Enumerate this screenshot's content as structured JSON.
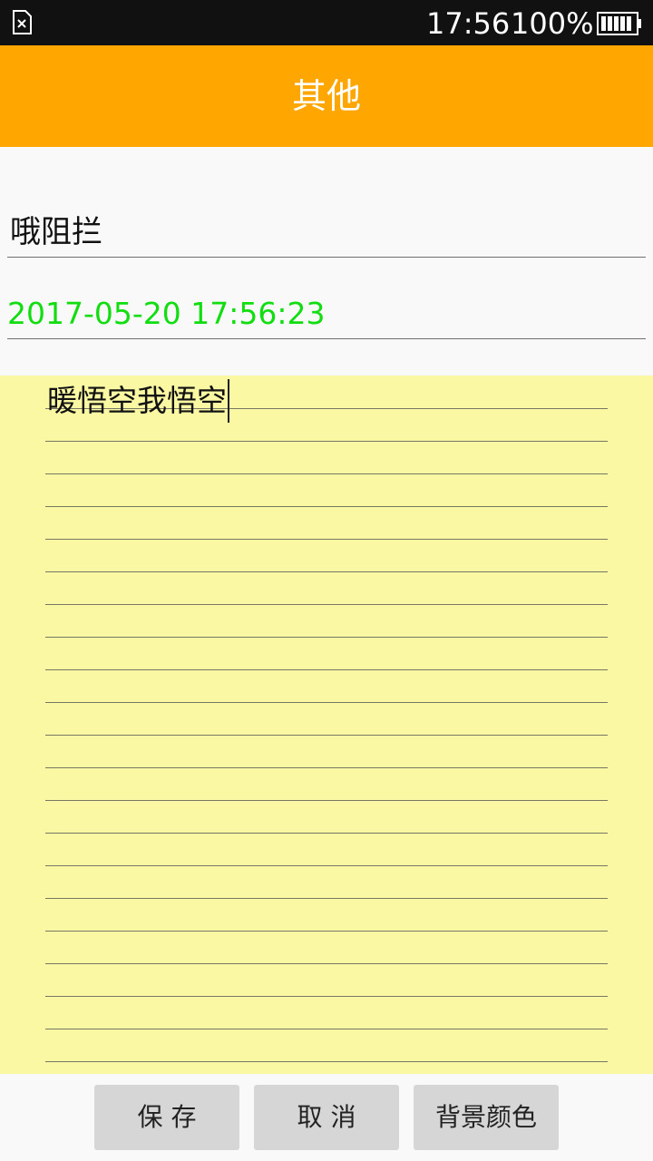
{
  "status_bar": {
    "time": "17:56",
    "battery_percent": "100%",
    "icons": [
      "sim-error-icon",
      "battery-full-icon"
    ]
  },
  "header": {
    "title": "其他",
    "color": "#ffa600"
  },
  "form": {
    "title_value": "哦阻拦",
    "date_value": "2017-05-20 17:56:23",
    "date_color": "#11dd11"
  },
  "note": {
    "content": "暖悟空我悟空",
    "background_color": "#faf8a3"
  },
  "buttons": {
    "save_label": "保 存",
    "cancel_label": "取 消",
    "background_label": "背景颜色"
  }
}
